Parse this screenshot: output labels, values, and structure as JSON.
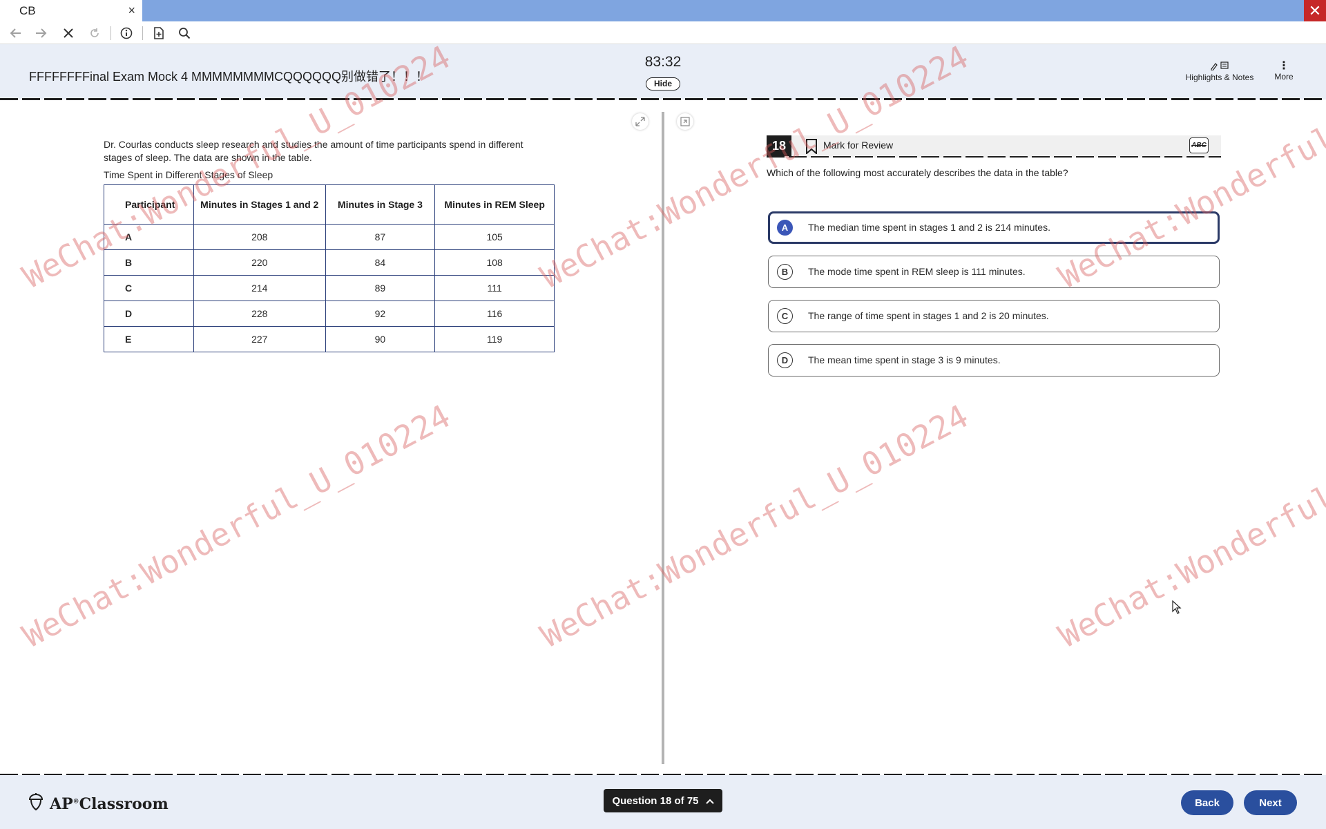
{
  "browser": {
    "tab_title": "CB",
    "tab_close": "×",
    "window_close": "✕"
  },
  "header": {
    "exam_title": "FFFFFFFFinal Exam Mock 4 MMMMMMMMCQQQQQQ别做错了！！！",
    "timer": "83:32",
    "hide_label": "Hide",
    "highlights_label": "Highlights & Notes",
    "more_label": "More"
  },
  "passage": {
    "text": "Dr. Courlas conducts sleep research and studies the amount of time participants spend in different stages of sleep. The data are shown in the table.",
    "table_title": "Time Spent in Different Stages of Sleep",
    "columns": [
      "Participant",
      "Minutes in Stages 1 and 2",
      "Minutes in Stage 3",
      "Minutes in REM Sleep"
    ],
    "rows": [
      [
        "A",
        "208",
        "87",
        "105"
      ],
      [
        "B",
        "220",
        "84",
        "108"
      ],
      [
        "C",
        "214",
        "89",
        "111"
      ],
      [
        "D",
        "228",
        "92",
        "116"
      ],
      [
        "E",
        "227",
        "90",
        "119"
      ]
    ]
  },
  "question": {
    "number": "18",
    "mark_for_review": "Mark for Review",
    "abc_label": "ABC",
    "prompt": "Which of the following most accurately describes the data in the table?",
    "selected": "A",
    "choices": [
      {
        "letter": "A",
        "text": "The median time spent in stages 1 and 2 is 214 minutes."
      },
      {
        "letter": "B",
        "text": "The mode time spent in REM sleep is 111 minutes."
      },
      {
        "letter": "C",
        "text": "The range of time spent in stages 1 and 2 is 20 minutes."
      },
      {
        "letter": "D",
        "text": "The mean time spent in stage 3 is 9 minutes."
      }
    ]
  },
  "footer": {
    "logo_text": "AP",
    "logo_sup": "®",
    "logo_text2": "Classroom",
    "question_nav": "Question 18 of 75",
    "back_label": "Back",
    "next_label": "Next"
  },
  "watermark": "WeChat:Wonderful_U_010224",
  "colors": {
    "accent": "#2a4f9e",
    "selected_choice": "#3b56b8",
    "header_bg": "#e9eef7",
    "watermark": "#d65a5a"
  }
}
